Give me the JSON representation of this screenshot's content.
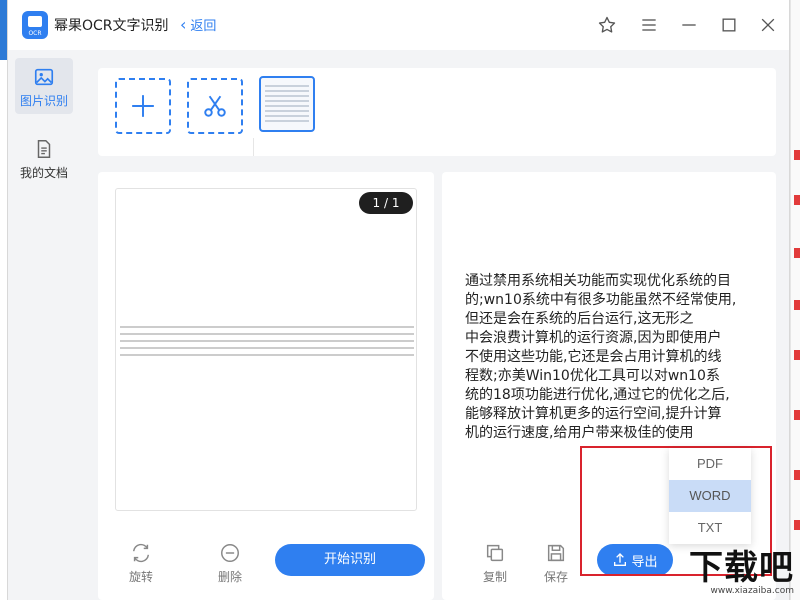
{
  "app": {
    "title": "幂果OCR文字识别",
    "logo_text": "OCR",
    "back_label": "返回",
    "accent_color": "#2f7ff0",
    "highlight_color": "#d9232d"
  },
  "titlebar_icons": [
    "star-icon",
    "menu-icon",
    "minimize-icon",
    "maximize-icon",
    "close-icon"
  ],
  "sidebar": {
    "items": [
      {
        "label": "图片识别",
        "icon": "image-icon",
        "active": true
      },
      {
        "label": "我的文档",
        "icon": "document-icon",
        "active": false
      }
    ]
  },
  "toolbar": {
    "buttons": [
      {
        "name": "add-image-button",
        "icon": "plus-icon"
      },
      {
        "name": "crop-button",
        "icon": "scissors-icon"
      }
    ]
  },
  "preview": {
    "page_indicator": "1 / 1"
  },
  "image_actions": {
    "rotate_label": "旋转",
    "delete_label": "删除",
    "start_label": "开始识别"
  },
  "result": {
    "lines": [
      "通过禁用系统相关功能而实现优化系统的目",
      "的;wn10系统中有很多功能虽然不经常使用,",
      "但还是会在系统的后台运行,这无形之",
      "中会浪费计算机的运行资源,因为即使用户",
      "不使用这些功能,它还是会占用计算机的线",
      "程数;亦美Win10优化工具可以对wn10系",
      "统的18项功能进行优化,通过它的优化之后,",
      "能够释放计算机更多的运行空间,提升计算",
      "机的运行速度,给用户带来极佳的使用"
    ]
  },
  "result_actions": {
    "copy_label": "复制",
    "save_label": "保存",
    "export_label": "导出"
  },
  "export_menu": {
    "options": [
      "PDF",
      "WORD",
      "TXT"
    ],
    "selected": "WORD"
  },
  "watermark": {
    "text": "下载吧",
    "url": "www.xiazaiba.com"
  }
}
